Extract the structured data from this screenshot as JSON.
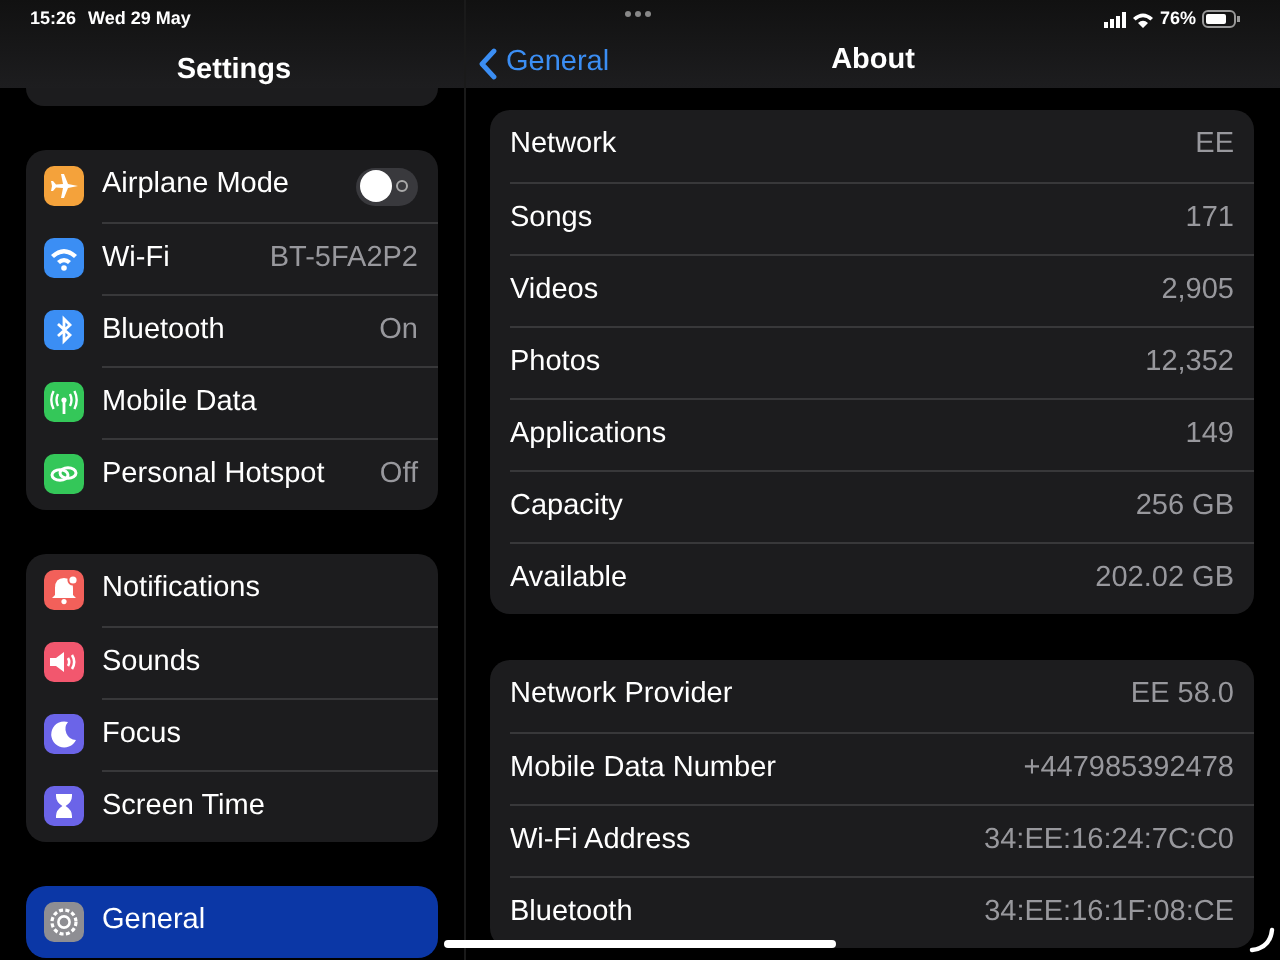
{
  "status_bar": {
    "time": "15:26",
    "date": "Wed 29 May",
    "battery": "76%"
  },
  "sidebar": {
    "title": "Settings",
    "groups": [
      {
        "items": [
          {
            "label": "Airplane Mode",
            "kind": "toggle",
            "on": false,
            "color": "#f4a23b",
            "selected": false
          },
          {
            "label": "Wi-Fi",
            "kind": "value",
            "value": "BT-5FA2P2",
            "color": "#3b8ef4",
            "selected": false
          },
          {
            "label": "Bluetooth",
            "kind": "value",
            "value": "On",
            "color": "#3b8ef4",
            "selected": false
          },
          {
            "label": "Mobile Data",
            "kind": "plain",
            "color": "#34c759",
            "selected": false
          },
          {
            "label": "Personal Hotspot",
            "kind": "value",
            "value": "Off",
            "color": "#34c759",
            "selected": false
          }
        ]
      },
      {
        "items": [
          {
            "label": "Notifications",
            "kind": "plain",
            "color": "#f2605a",
            "selected": false
          },
          {
            "label": "Sounds",
            "kind": "plain",
            "color": "#f2576e",
            "selected": false
          },
          {
            "label": "Focus",
            "kind": "plain",
            "color": "#6b64e8",
            "selected": false
          },
          {
            "label": "Screen Time",
            "kind": "plain",
            "color": "#6b64e8",
            "selected": false
          }
        ]
      },
      {
        "items": [
          {
            "label": "General",
            "kind": "plain",
            "color": "#8e8e93",
            "selected": true
          }
        ]
      }
    ]
  },
  "detail": {
    "back": "General",
    "title": "About",
    "groups": [
      {
        "rows": [
          {
            "label": "Network",
            "value": "EE"
          },
          {
            "label": "Songs",
            "value": "171"
          },
          {
            "label": "Videos",
            "value": "2,905"
          },
          {
            "label": "Photos",
            "value": "12,352"
          },
          {
            "label": "Applications",
            "value": "149"
          },
          {
            "label": "Capacity",
            "value": "256 GB"
          },
          {
            "label": "Available",
            "value": "202.02 GB"
          }
        ]
      },
      {
        "rows": [
          {
            "label": "Network Provider",
            "value": "EE 58.0"
          },
          {
            "label": "Mobile Data Number",
            "value": "+447985392478"
          },
          {
            "label": "Wi-Fi Address",
            "value": "34:EE:16:24:7C:C0"
          },
          {
            "label": "Bluetooth",
            "value": "34:EE:16:1F:08:CE"
          }
        ]
      }
    ]
  }
}
